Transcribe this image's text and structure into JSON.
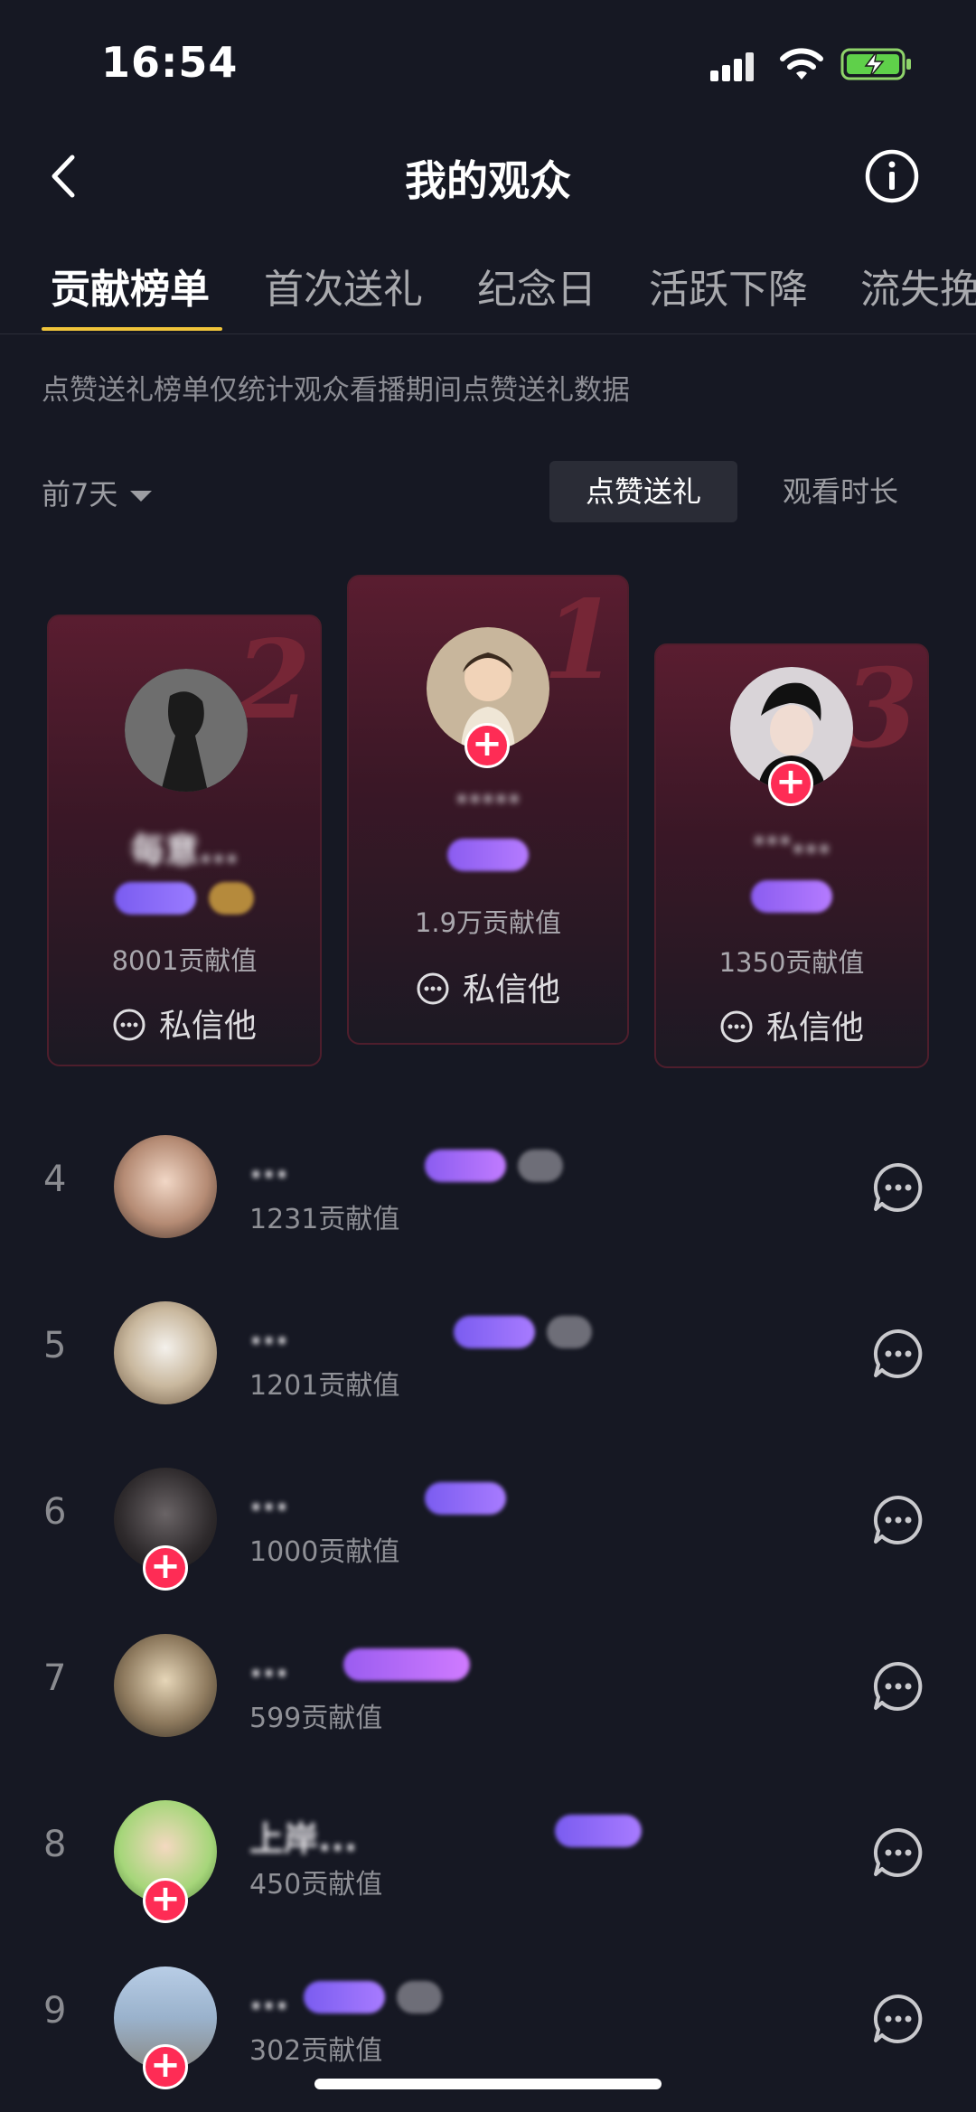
{
  "status_bar": {
    "time": "16:54"
  },
  "header": {
    "title": "我的观众"
  },
  "tabs": [
    {
      "label": "贡献榜单",
      "active": true
    },
    {
      "label": "首次送礼",
      "active": false
    },
    {
      "label": "纪念日",
      "active": false
    },
    {
      "label": "活跃下降",
      "active": false
    },
    {
      "label": "流失挽",
      "active": false
    }
  ],
  "notice": "点赞送礼榜单仅统计观众看播期间点赞送礼数据",
  "filter": {
    "period": "前7天",
    "segments": [
      "点赞送礼",
      "观看时长"
    ],
    "selected_segment": "点赞送礼"
  },
  "podium": [
    {
      "rank": "2",
      "name": "每意...",
      "value": "8001贡献值",
      "message_label": "私信他"
    },
    {
      "rank": "1",
      "name": "·····",
      "value": "1.9万贡献值",
      "message_label": "私信他"
    },
    {
      "rank": "3",
      "name": "···...",
      "value": "1350贡献值",
      "message_label": "私信他"
    }
  ],
  "list": [
    {
      "rank": "4",
      "name": "...",
      "value": "1231贡献值",
      "has_follow": false
    },
    {
      "rank": "5",
      "name": "...",
      "value": "1201贡献值",
      "has_follow": false
    },
    {
      "rank": "6",
      "name": "...",
      "value": "1000贡献值",
      "has_follow": true
    },
    {
      "rank": "7",
      "name": "...",
      "value": "599贡献值",
      "has_follow": false
    },
    {
      "rank": "8",
      "name": "上岸...",
      "value": "450贡献值",
      "has_follow": true
    },
    {
      "rank": "9",
      "name": "...",
      "value": "302贡献值",
      "has_follow": true
    }
  ],
  "colors": {
    "background": "#161823",
    "tab_underline": "#f0c43a",
    "follow_plus": "#fe2c55",
    "card_top": "#5a1d30"
  }
}
